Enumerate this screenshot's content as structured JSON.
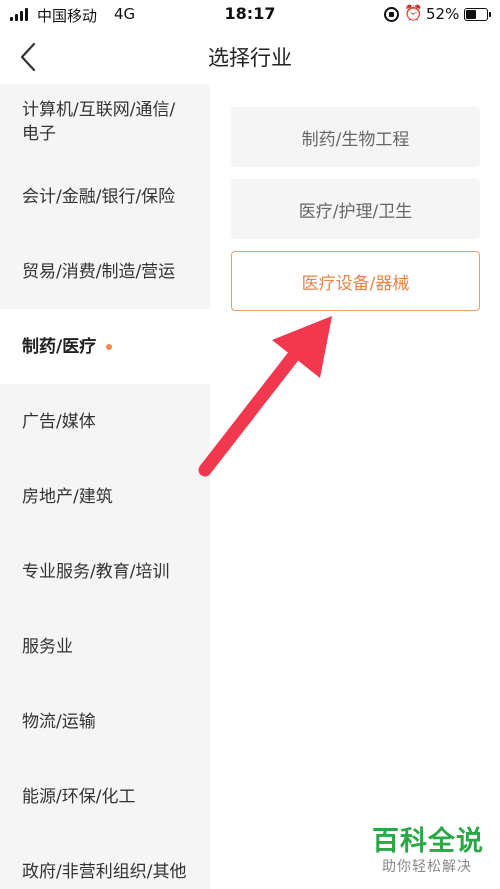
{
  "status_bar": {
    "carrier": "中国移动",
    "network": "4G",
    "time": "18:17",
    "battery_percent": "52%",
    "battery_level": 0.52
  },
  "nav": {
    "title": "选择行业"
  },
  "categories": [
    {
      "label": "计算机/互联网/通信/电子"
    },
    {
      "label": "会计/金融/银行/保险"
    },
    {
      "label": "贸易/消费/制造/营运"
    },
    {
      "label": "制药/医疗",
      "active": true
    },
    {
      "label": "广告/媒体"
    },
    {
      "label": "房地产/建筑"
    },
    {
      "label": "专业服务/教育/培训"
    },
    {
      "label": "服务业"
    },
    {
      "label": "物流/运输"
    },
    {
      "label": "能源/环保/化工"
    },
    {
      "label": "政府/非营利组织/其他"
    }
  ],
  "options": [
    {
      "label": "制药/生物工程"
    },
    {
      "label": "医疗/护理/卫生"
    },
    {
      "label": "医疗设备/器械",
      "selected": true
    }
  ],
  "colors": {
    "accent": "#e8844a",
    "arrow": "#f1384e",
    "watermark": "#2aa845"
  },
  "watermark": {
    "title": "百科全说",
    "subtitle": "助你轻松解决"
  }
}
